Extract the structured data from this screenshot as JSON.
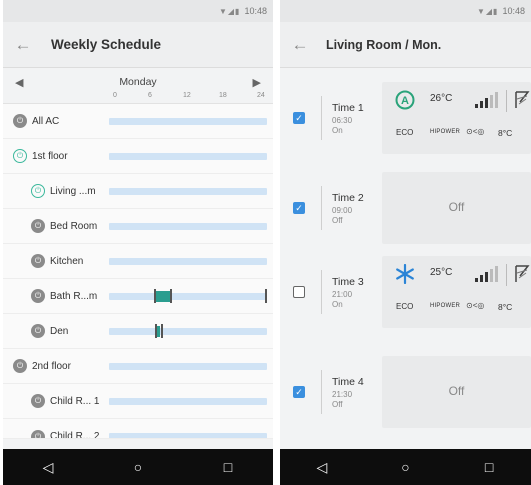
{
  "colors": {
    "bar": "#d0e3f5",
    "segment": "#2a9d8f",
    "checkbox": "#3b8fde",
    "auto_icon": "#2aa37a",
    "cool_icon": "#2b84d6"
  },
  "left_screen": {
    "status_time": "10:48",
    "title": "Weekly Schedule",
    "day": "Monday",
    "ticks": [
      "0",
      "6",
      "12",
      "18",
      "24"
    ],
    "rows": [
      {
        "label": "All AC",
        "icon": "ac-unit-icon"
      },
      {
        "label": "1st floor",
        "icon": "power-icon"
      },
      {
        "label": "Living ...m",
        "icon": "power-icon"
      },
      {
        "label": "Bed Room",
        "icon": "ac-unit-icon"
      },
      {
        "label": "Kitchen",
        "icon": "ac-unit-icon"
      },
      {
        "label": "Bath R...m",
        "icon": "ac-unit-icon"
      },
      {
        "label": "Den",
        "icon": "ac-unit-icon"
      },
      {
        "label": "2nd floor",
        "icon": "ac-unit-icon"
      },
      {
        "label": "Child R... 1",
        "icon": "ac-unit-icon"
      },
      {
        "label": "Child R... 2",
        "icon": "ac-unit-icon"
      }
    ]
  },
  "right_screen": {
    "status_time": "10:48",
    "title": "Living Room / Mon.",
    "times": [
      {
        "name": "Time 1",
        "time": "06:30",
        "state": "On",
        "checked": true,
        "panel": "on",
        "mode": "auto-mode-icon",
        "temp": "26°C",
        "eco": "ECO",
        "hipower": "HIPOWER",
        "vent": "⊙<◎",
        "setback": "8°C"
      },
      {
        "name": "Time 2",
        "time": "09:00",
        "state": "Off",
        "checked": true,
        "panel": "off",
        "off_label": "Off"
      },
      {
        "name": "Time 3",
        "time": "21:00",
        "state": "On",
        "checked": false,
        "panel": "on",
        "mode": "snowflake-icon",
        "temp": "25°C",
        "eco": "ECO",
        "hipower": "HIPOWER",
        "vent": "⊙<◎",
        "setback": "8°C"
      },
      {
        "name": "Time 4",
        "time": "21:30",
        "state": "Off",
        "checked": true,
        "panel": "off",
        "off_label": "Off"
      }
    ]
  },
  "navbar": {
    "back": "◁",
    "home": "○",
    "recents": "□"
  }
}
